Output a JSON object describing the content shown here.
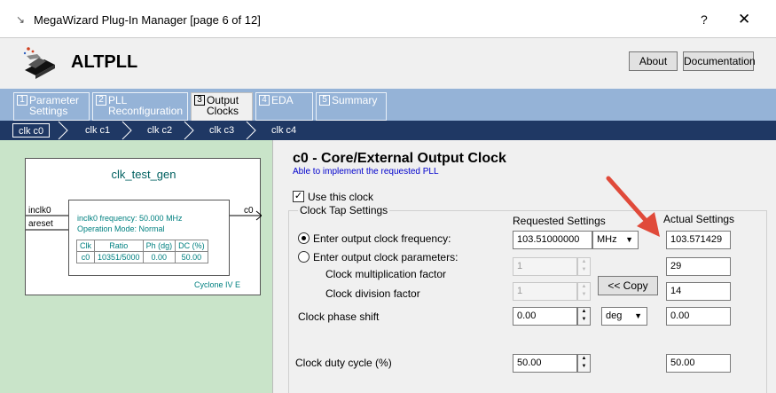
{
  "window": {
    "title": "MegaWizard Plug-In Manager [page 6 of 12]",
    "help": "?",
    "close": "✕",
    "icon": "pin-icon"
  },
  "header": {
    "title": "ALTPLL",
    "about": "About",
    "documentation": "Documentation"
  },
  "tabs": [
    {
      "num": "1",
      "label": "Parameter Settings",
      "l1": "Parameter",
      "l2": "Settings"
    },
    {
      "num": "2",
      "label": "PLL Reconfiguration",
      "l1": "PLL",
      "l2": "Reconfiguration"
    },
    {
      "num": "3",
      "label": "Output Clocks",
      "l1": "Output",
      "l2": "Clocks",
      "active": true
    },
    {
      "num": "4",
      "label": "EDA",
      "l1": "EDA",
      "l2": ""
    },
    {
      "num": "5",
      "label": "Summary",
      "l1": "Summary",
      "l2": ""
    }
  ],
  "clocks": [
    "clk c0",
    "clk c1",
    "clk c2",
    "clk c3",
    "clk c4"
  ],
  "block": {
    "name": "clk_test_gen",
    "inputs": [
      "inclk0",
      "areset"
    ],
    "output": "c0",
    "info1": "inclk0 frequency: 50.000 MHz",
    "info2": "Operation Mode: Normal",
    "table_headers": [
      "Clk",
      "Ratio",
      "Ph (dg)",
      "DC (%)"
    ],
    "table_row": [
      "c0",
      "10351/5000",
      "0.00",
      "50.00"
    ],
    "device": "Cyclone IV E"
  },
  "section": {
    "title": "c0 - Core/External Output Clock",
    "subtitle": "Able to implement the requested PLL",
    "use_clock": "Use this clock",
    "tap_settings": "Clock Tap Settings",
    "requested": "Requested Settings",
    "actual": "Actual Settings",
    "enter_freq": "Enter output clock frequency:",
    "enter_params": "Enter output clock parameters:",
    "mult_factor": "Clock multiplication factor",
    "div_factor": "Clock division factor",
    "phase_shift": "Clock phase shift",
    "duty_cycle": "Clock duty cycle (%)",
    "copy": "<< Copy",
    "freq_value": "103.51000000",
    "freq_unit": "MHz",
    "actual_freq": "103.571429",
    "mult_req": "1",
    "div_req": "1",
    "mult_actual": "29",
    "div_actual": "14",
    "phase_req": "0.00",
    "phase_unit": "deg",
    "phase_actual": "0.00",
    "duty_req": "50.00",
    "duty_actual": "50.00"
  },
  "colors": {
    "tab_bar": "#95b3d7",
    "clock_bar": "#1f3864",
    "diagram_bg": "#c9e4c9",
    "annotation_arrow": "#e04a3a"
  }
}
